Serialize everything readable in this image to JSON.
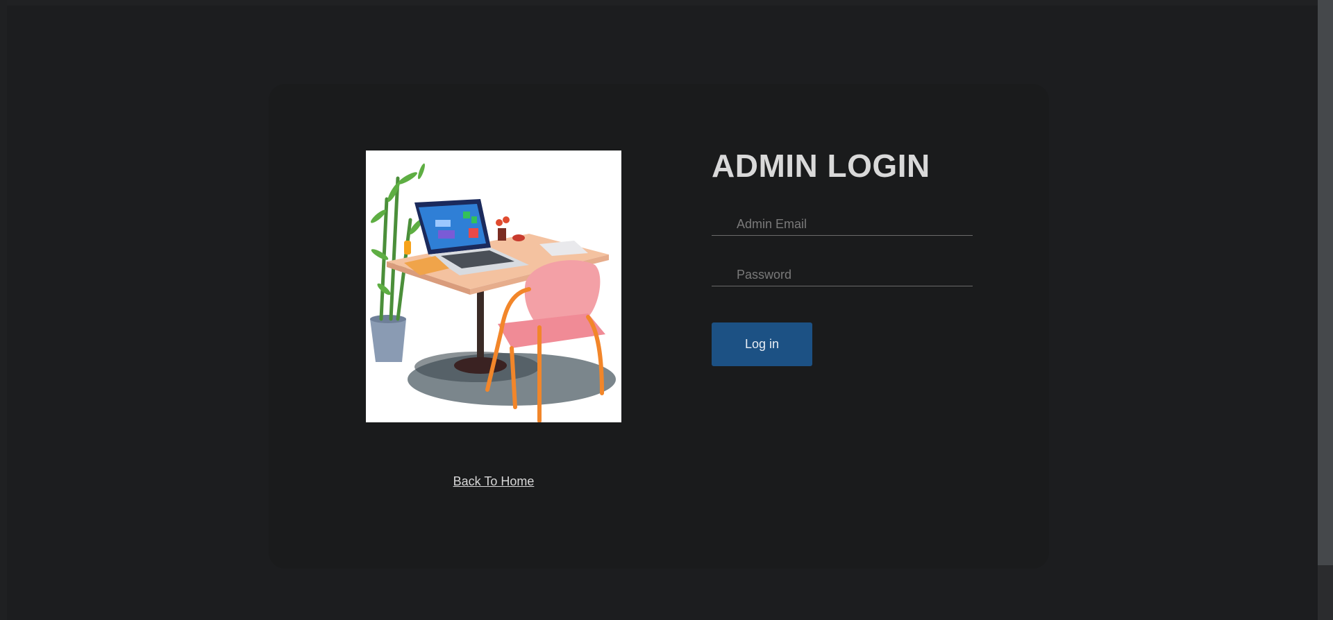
{
  "login": {
    "title": "ADMIN LOGIN",
    "email_placeholder": "Admin Email",
    "password_placeholder": "Password",
    "submit_label": "Log in",
    "back_link": "Back To Home"
  },
  "colors": {
    "background": "#1c1d1f",
    "card": "#1a1b1c",
    "button": "#1c5184",
    "title_text": "#d9d9d9"
  },
  "illustration": {
    "subject": "desk-laptop-chair-plant-illustration"
  }
}
